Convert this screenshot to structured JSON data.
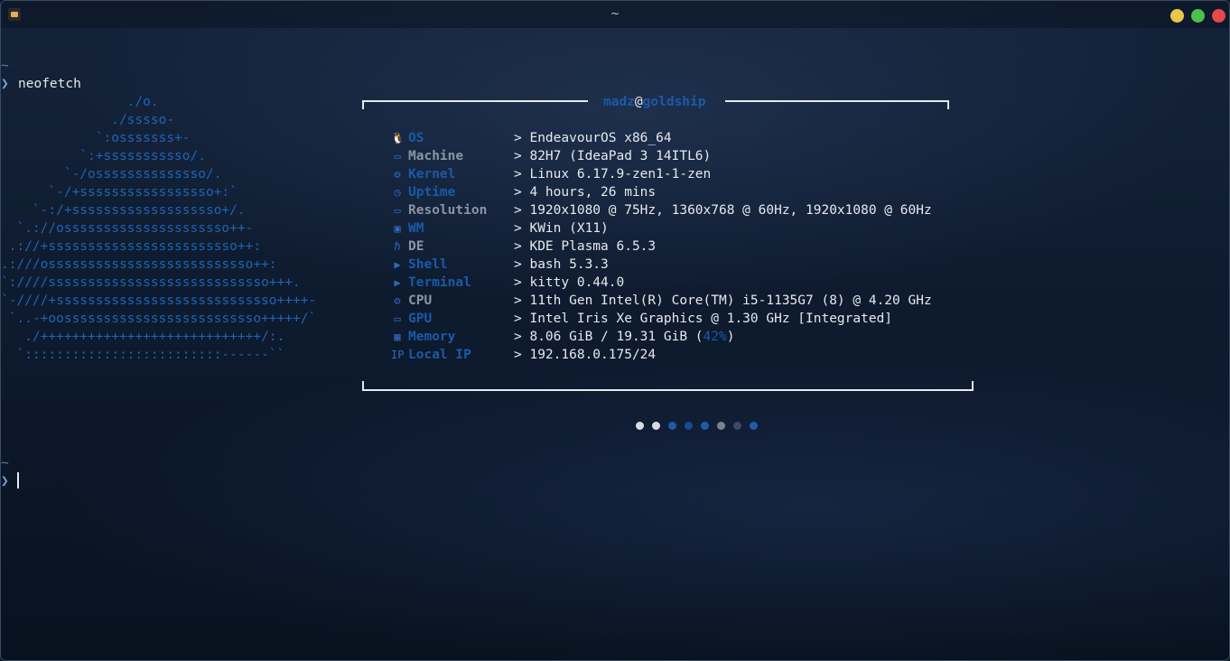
{
  "window": {
    "title": "~"
  },
  "terminal": {
    "tilde": "~",
    "prompt_symbol": "❯",
    "command": "neofetch",
    "ascii_art": [
      "                ./o.",
      "              ./sssso-",
      "            `:osssssss+-",
      "          `:+sssssssssso/.",
      "        `-/ossssssssssssso/.",
      "      `-/+sssssssssssssssso+:`",
      "    `-:/+sssssssssssssssssso+/.",
      "  `.://osssssssssssssssssssso++-",
      " .://+ssssssssssssssssssssssso++:",
      ".:///ossssssssssssssssssssssssso++:",
      "`:////ssssssssssssssssssssssssssso+++.",
      "`-////+ssssssssssssssssssssssssssso++++-",
      " `..-+oosssssssssssssssssssssssso+++++/`",
      "   ./++++++++++++++++++++++++++++/:.",
      "  `:::::::::::::::::::::::::------``"
    ],
    "user": "madz",
    "at": "@",
    "host": "goldship",
    "separator": ">",
    "info": [
      {
        "icon": "linux-penguin-icon",
        "glyph": "🐧",
        "key": "OS",
        "value": "EndeavourOS x86_64",
        "grey": false
      },
      {
        "icon": "laptop-icon",
        "glyph": "▭",
        "key": "Machine",
        "value": "82H7 (IdeaPad 3 14ITL6)",
        "grey": true
      },
      {
        "icon": "gear-icon",
        "glyph": "⚙",
        "key": "Kernel",
        "value": "Linux 6.17.9-zen1-1-zen",
        "grey": false
      },
      {
        "icon": "clock-icon",
        "glyph": "◷",
        "key": "Uptime",
        "value": "4 hours, 26 mins",
        "grey": false
      },
      {
        "icon": "monitor-icon",
        "glyph": "▭",
        "key": "Resolution",
        "value": "1920x1080 @ 75Hz, 1360x768 @ 60Hz, 1920x1080 @ 60Hz",
        "grey": true
      },
      {
        "icon": "window-icon",
        "glyph": "▣",
        "key": "WM",
        "value": "KWin (X11)",
        "grey": false
      },
      {
        "icon": "desktop-environment-icon",
        "glyph": "ℏ",
        "key": "DE",
        "value": "KDE Plasma 6.5.3",
        "grey": true
      },
      {
        "icon": "shell-icon",
        "glyph": "▶",
        "key": "Shell",
        "value": "bash 5.3.3",
        "grey": false
      },
      {
        "icon": "terminal-icon",
        "glyph": "▶",
        "key": "Terminal",
        "value": "kitty 0.44.0",
        "grey": false
      },
      {
        "icon": "cpu-icon",
        "glyph": "⚙",
        "key": "CPU",
        "value": "11th Gen Intel(R) Core(TM) i5-1135G7 (8) @ 4.20 GHz",
        "grey": true
      },
      {
        "icon": "gpu-icon",
        "glyph": "▭",
        "key": "GPU",
        "value": "Intel Iris Xe Graphics @ 1.30 GHz [Integrated]",
        "grey": false
      },
      {
        "icon": "memory-icon",
        "glyph": "▦",
        "key": "Memory",
        "value": "8.06 GiB / 19.31 GiB (",
        "value_pct": "42%",
        "value_end": ")",
        "grey": false
      },
      {
        "icon": "network-icon",
        "glyph": "IP",
        "key": "Local IP",
        "value": "192.168.0.175/24",
        "grey": false
      }
    ],
    "color_dots": [
      "#d8dce2",
      "#d8dce2",
      "#1e5ba8",
      "#1a4c90",
      "#1e5ba8",
      "#7a8290",
      "#3a4a60",
      "#1e5ba8"
    ]
  }
}
